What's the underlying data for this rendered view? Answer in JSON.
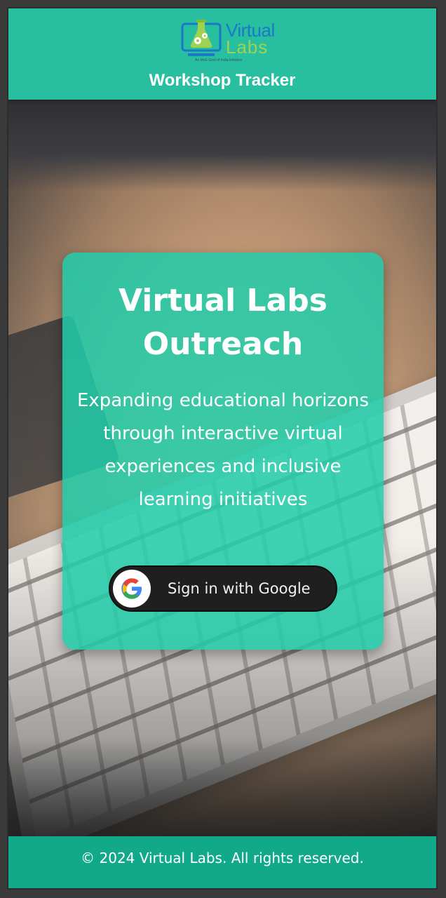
{
  "header": {
    "logo": {
      "text_line1": "Virtual",
      "text_line2": "Labs",
      "tagline": "An MoE Govt of India Initiative",
      "icon": "flask-gear-icon"
    },
    "title": "Workshop Tracker"
  },
  "card": {
    "title": "Virtual Labs Outreach",
    "subtitle": "Expanding educational horizons through interactive virtual experiences and inclusive learning initiatives",
    "signin_button": {
      "label": "Sign in with Google",
      "icon": "google-g-icon"
    }
  },
  "footer": {
    "text": "© 2024 Virtual Labs. All rights reserved."
  },
  "colors": {
    "header_bg": "#27bfa0",
    "card_bg": "#21cca9",
    "footer_bg": "#12a98a",
    "button_bg": "#1f1f1f"
  }
}
